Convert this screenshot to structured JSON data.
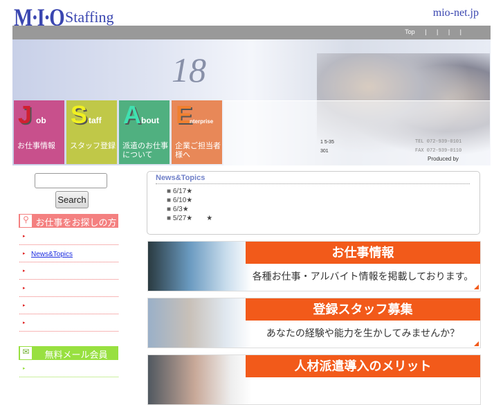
{
  "header": {
    "logo_mark": "M·I·O",
    "logo_text": "Staffing",
    "domain": "mio-net.jp"
  },
  "nav": {
    "links": "Top |   |   |   |"
  },
  "hero": {
    "number": "18",
    "tiles": [
      {
        "letter": "J",
        "rest": "ob",
        "jp": "お仕事情報",
        "color": "#c8508c"
      },
      {
        "letter": "S",
        "rest": "taff",
        "jp": "スタッフ登録",
        "color": "#c0c848"
      },
      {
        "letter": "A",
        "rest": "bout",
        "jp": "派遣のお仕事について",
        "color": "#50b080"
      },
      {
        "letter": "E",
        "rest": "nterprise",
        "jp": "企業ご担当者様へ",
        "color": "#e88858"
      }
    ],
    "address_line1": "1  5-35",
    "address_line2": "301",
    "tel": "TEL 072-939-0101",
    "fax": "FAX 072-939-0110",
    "produced": "Produced by"
  },
  "sidebar": {
    "search_button": "Search",
    "search_placeholder": "",
    "job_header": "お仕事をお探しの方へ",
    "job_items": [
      "",
      "News&Topics",
      "",
      "",
      "",
      ""
    ],
    "mail_header": "無料メール会員"
  },
  "news": {
    "title": "News&Topics",
    "items": [
      "6/17★",
      "6/10★",
      "6/3★",
      "5/27★　　★"
    ]
  },
  "banners": [
    {
      "title": "お仕事情報",
      "subtitle": "各種お仕事・アルバイト情報を掲載しております。"
    },
    {
      "title": "登録スタッフ募集",
      "subtitle": "あなたの経験や能力を生かしてみませんか？"
    },
    {
      "title": "人材派遣導入のメリット",
      "subtitle": ""
    }
  ]
}
